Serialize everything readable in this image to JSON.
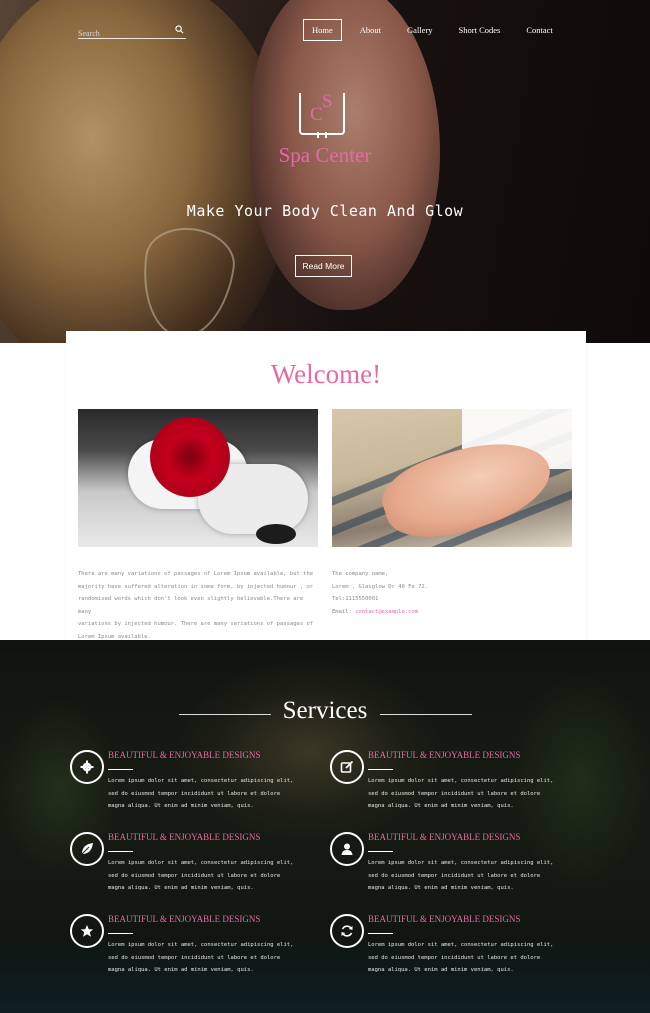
{
  "search": {
    "placeholder": "Search"
  },
  "nav": {
    "items": [
      "Home",
      "About",
      "Gallery",
      "Short Codes",
      "Contact"
    ],
    "active": "Home"
  },
  "hero": {
    "logo_c": "C",
    "logo_s": "S",
    "brand": "Spa Center",
    "tagline": "Make Your Body Clean And Glow",
    "button": "Read More"
  },
  "welcome": {
    "title": "Welcome!",
    "body_lines": [
      "There are many variations of passages of Lorem Ipsum available, but the",
      "majority have suffered alteration in some form, by injected humour , or",
      "randomised words which don't look even slightly believable.There are many",
      "variations by injected humour. There are many variations of passages of",
      "Lorem Ipsum available."
    ],
    "contact": {
      "company": "The company name,",
      "address": "Lorem , Glasglow Dr 40 Fe 72.",
      "phone": "Tel:1115550001",
      "email_label": "Email: ",
      "email": "contact@example.com"
    }
  },
  "services": {
    "title": "Services",
    "items": [
      {
        "icon": "gear-icon",
        "heading": "BEAUTIFUL & ENJOYABLE DESIGNS",
        "lines": [
          "Lorem ipsum dolor sit amet, consectetur adipiscing elit,",
          "sed do eiusmod tempor incididunt ut labore et dolore",
          "magna aliqua. Ut enim ad minim veniam, quis."
        ]
      },
      {
        "icon": "edit-icon",
        "heading": "BEAUTIFUL & ENJOYABLE DESIGNS",
        "lines": [
          "Lorem ipsum dolor sit amet, consectetur adipiscing elit,",
          "sed do eiusmod tempor incididunt ut labore et dolore",
          "magna aliqua. Ut enim ad minim veniam, quis."
        ]
      },
      {
        "icon": "leaf-icon",
        "heading": "BEAUTIFUL & ENJOYABLE DESIGNS",
        "lines": [
          "Lorem ipsum dolor sit amet, consectetur adipiscing elit,",
          "sed do eiusmod tempor incididunt ut labore et dolore",
          "magna aliqua. Ut enim ad minim veniam, quis."
        ]
      },
      {
        "icon": "user-icon",
        "heading": "BEAUTIFUL & ENJOYABLE DESIGNS",
        "lines": [
          "Lorem ipsum dolor sit amet, consectetur adipiscing elit,",
          "sed do eiusmod tempor incididunt ut labore et dolore",
          "magna aliqua. Ut enim ad minim veniam, quis."
        ]
      },
      {
        "icon": "star-icon",
        "heading": "BEAUTIFUL & ENJOYABLE DESIGNS",
        "lines": [
          "Lorem ipsum dolor sit amet, consectetur adipiscing elit,",
          "sed do eiusmod tempor incididunt ut labore et dolore",
          "magna aliqua. Ut enim ad minim veniam, quis."
        ]
      },
      {
        "icon": "refresh-icon",
        "heading": "BEAUTIFUL & ENJOYABLE DESIGNS",
        "lines": [
          "Lorem ipsum dolor sit amet, consectetur adipiscing elit,",
          "sed do eiusmod tempor incididunt ut labore et dolore",
          "magna aliqua. Ut enim ad minim veniam, quis."
        ]
      }
    ]
  },
  "colors": {
    "accent": "#e46aa6",
    "text_muted": "#8a8a8a"
  }
}
